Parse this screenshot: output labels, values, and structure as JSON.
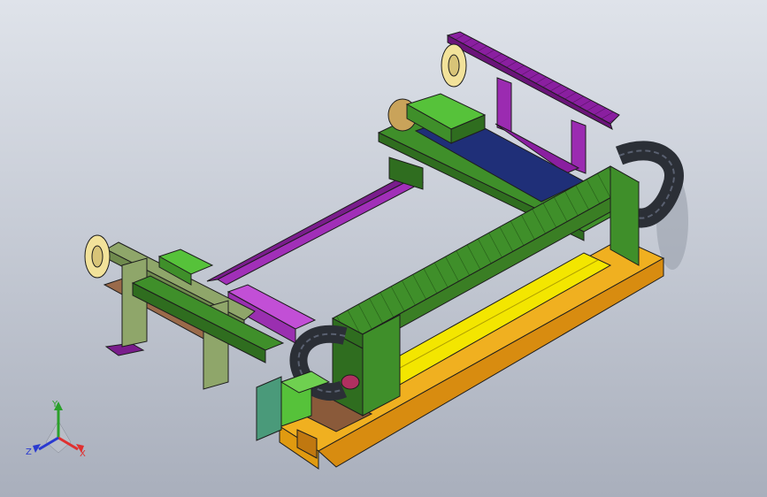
{
  "view": {
    "colors": {
      "bg_top": "#dfe3ea",
      "bg_bottom": "#a9afbc",
      "outline": "#1d1d1d",
      "green": "#3f8f2a",
      "green_light": "#56c23a",
      "green_dark": "#2f6d1f",
      "purple": "#8a1fa0",
      "magenta": "#c24fd6",
      "navy": "#1f2f78",
      "yellow": "#f3e600",
      "orange": "#f0b020",
      "brown": "#8a5a3a",
      "olive": "#8fa66a",
      "teal": "#4a9a7a",
      "chain": "#2b2f36",
      "cream": "#f2e29a"
    }
  },
  "triad": {
    "x_label": "X",
    "y_label": "Y",
    "z_label": "Z",
    "x_color": "#e03030",
    "y_color": "#2aa02a",
    "z_color": "#2a3ad0"
  }
}
